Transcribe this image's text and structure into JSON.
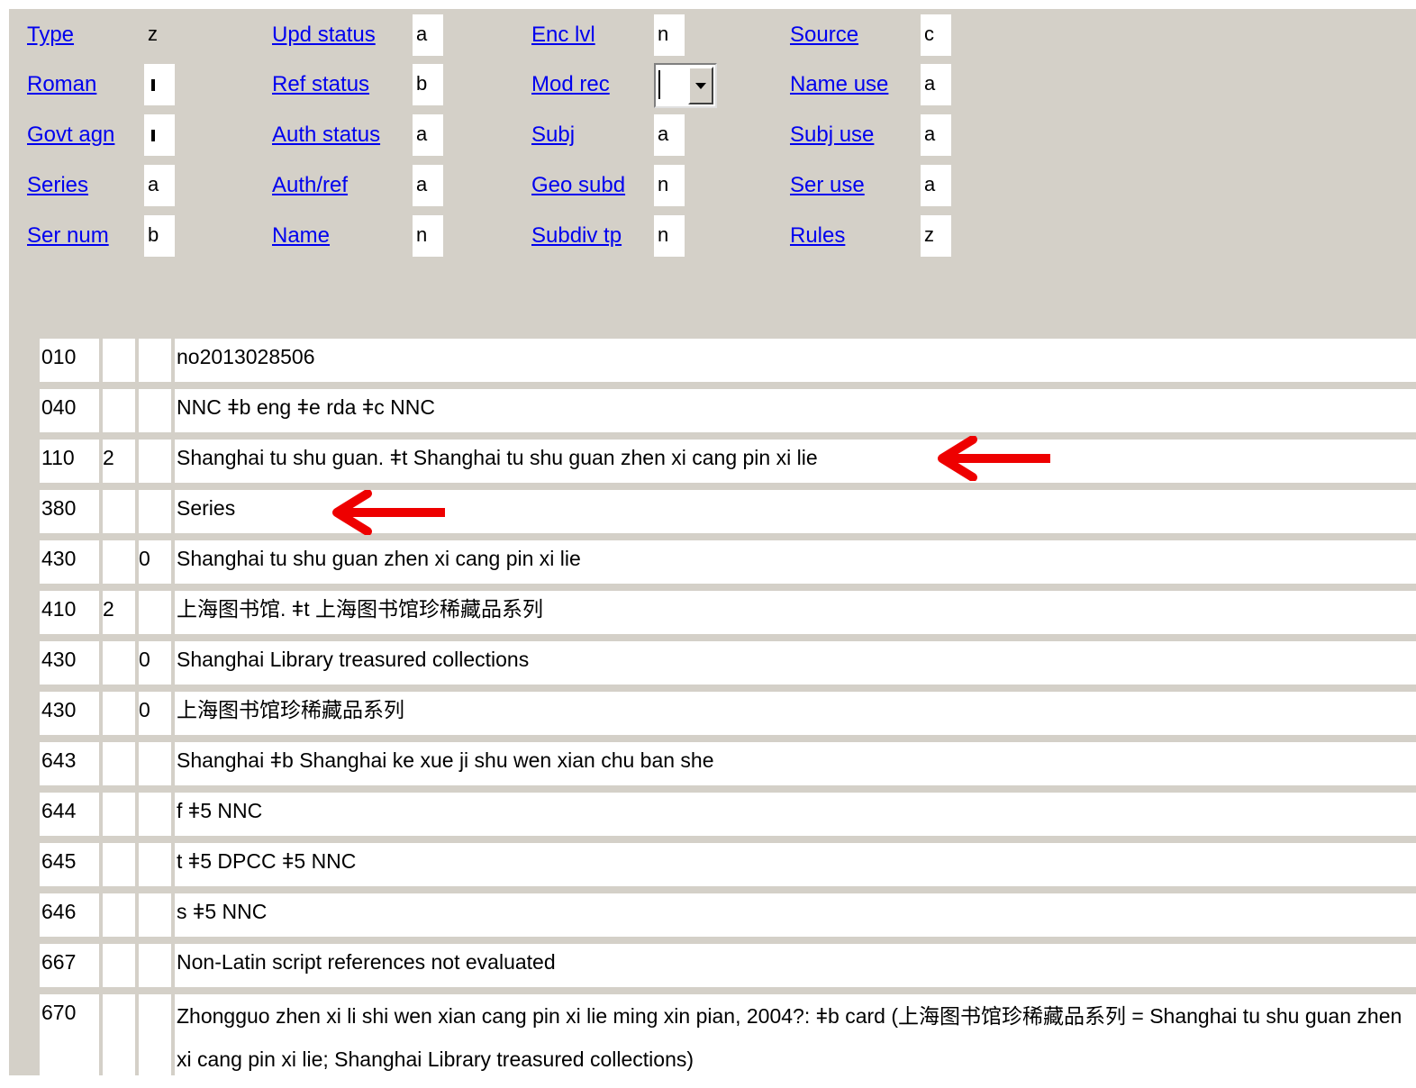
{
  "fixed_fields": [
    {
      "label": "Type",
      "value": "z"
    },
    {
      "label": "Upd status",
      "value": "a"
    },
    {
      "label": "Enc lvl",
      "value": "n"
    },
    {
      "label": "Source",
      "value": "c"
    },
    {
      "label": "Roman",
      "value": "fill"
    },
    {
      "label": "Ref status",
      "value": "b"
    },
    {
      "label": "Mod rec",
      "value": ""
    },
    {
      "label": "Name use",
      "value": "a"
    },
    {
      "label": "Govt agn",
      "value": "fill"
    },
    {
      "label": "Auth status",
      "value": "a"
    },
    {
      "label": "Subj",
      "value": "a"
    },
    {
      "label": "Subj use",
      "value": "a"
    },
    {
      "label": "Series",
      "value": "a"
    },
    {
      "label": "Auth/ref",
      "value": "a"
    },
    {
      "label": "Geo subd",
      "value": "n"
    },
    {
      "label": "Ser use",
      "value": "a"
    },
    {
      "label": "Ser num",
      "value": "b"
    },
    {
      "label": "Name",
      "value": "n"
    },
    {
      "label": "Subdiv tp",
      "value": "n"
    },
    {
      "label": "Rules",
      "value": "z"
    }
  ],
  "fields": [
    {
      "tag": "010",
      "ind1": "",
      "ind2": "",
      "data": "no2013028506"
    },
    {
      "tag": "040",
      "ind1": "",
      "ind2": "",
      "data": "NNC ǂb eng ǂe rda ǂc NNC"
    },
    {
      "tag": "110",
      "ind1": "2",
      "ind2": "",
      "data": "Shanghai tu shu guan. ǂt Shanghai tu shu guan zhen xi cang pin xi lie"
    },
    {
      "tag": "380",
      "ind1": "",
      "ind2": "",
      "data": "Series"
    },
    {
      "tag": "430",
      "ind1": "",
      "ind2": "0",
      "data": "Shanghai tu shu guan zhen xi cang pin xi lie"
    },
    {
      "tag": "410",
      "ind1": "2",
      "ind2": "",
      "data": "上海图书馆. ǂt 上海图书馆珍稀藏品系列"
    },
    {
      "tag": "430",
      "ind1": "",
      "ind2": "0",
      "data": "Shanghai Library treasured collections"
    },
    {
      "tag": "430",
      "ind1": "",
      "ind2": "0",
      "data": "上海图书馆珍稀藏品系列"
    },
    {
      "tag": "643",
      "ind1": "",
      "ind2": "",
      "data": "Shanghai ǂb Shanghai ke xue ji shu wen xian chu ban she"
    },
    {
      "tag": "644",
      "ind1": "",
      "ind2": "",
      "data": "f ǂ5 NNC"
    },
    {
      "tag": "645",
      "ind1": "",
      "ind2": "",
      "data": "t ǂ5 DPCC ǂ5 NNC"
    },
    {
      "tag": "646",
      "ind1": "",
      "ind2": "",
      "data": "s ǂ5 NNC"
    },
    {
      "tag": "667",
      "ind1": "",
      "ind2": "",
      "data": "Non-Latin script references not evaluated"
    },
    {
      "tag": "670",
      "ind1": "",
      "ind2": "",
      "data": "Zhongguo zhen xi li shi wen xian cang pin xi lie ming xin pian, 2004?: ǂb card (上海图书馆珍稀藏品系列 = Shanghai tu shu guan zhen xi cang pin xi lie; Shanghai Library treasured collections)"
    }
  ],
  "annotation_color": "#ee0000"
}
